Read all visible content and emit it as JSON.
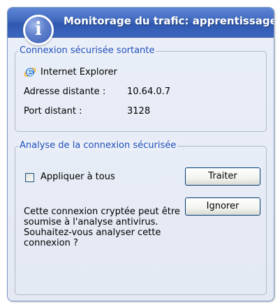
{
  "window": {
    "title": "Monitorage du trafic: apprentissage",
    "icon": "info-icon",
    "icon_glyph": "i"
  },
  "outgoing": {
    "legend": "Connexion sécurisée sortante",
    "browser_icon": "internet-explorer-icon",
    "browser": "Internet Explorer",
    "address_label": "Adresse distante :",
    "address_value": "10.64.0.7",
    "port_label": "Port distant :",
    "port_value": "3128"
  },
  "analysis": {
    "legend": "Analyse de la connexion sécurisée",
    "apply_all_label": "Appliquer à tous",
    "apply_all_checked": false,
    "treat_button": "Traiter",
    "ignore_button": "Ignorer",
    "message": "Cette connexion cryptée peut être soumise à l'analyse antivirus. Souhaitez-vous analyser cette connexion ?"
  },
  "colors": {
    "title_bar": "#3f68bd",
    "legend_text": "#1f4fba",
    "window_background": "#e9eef8"
  }
}
